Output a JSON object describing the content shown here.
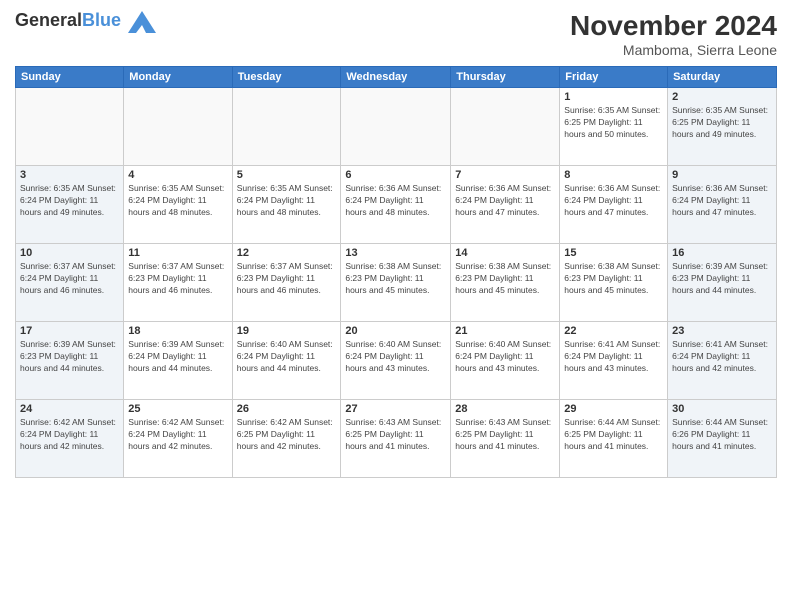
{
  "header": {
    "logo": {
      "general": "General",
      "blue": "Blue"
    },
    "title": "November 2024",
    "location": "Mamboma, Sierra Leone"
  },
  "weekdays": [
    "Sunday",
    "Monday",
    "Tuesday",
    "Wednesday",
    "Thursday",
    "Friday",
    "Saturday"
  ],
  "weeks": [
    [
      {
        "day": "",
        "info": ""
      },
      {
        "day": "",
        "info": ""
      },
      {
        "day": "",
        "info": ""
      },
      {
        "day": "",
        "info": ""
      },
      {
        "day": "",
        "info": ""
      },
      {
        "day": "1",
        "info": "Sunrise: 6:35 AM\nSunset: 6:25 PM\nDaylight: 11 hours and 50 minutes."
      },
      {
        "day": "2",
        "info": "Sunrise: 6:35 AM\nSunset: 6:25 PM\nDaylight: 11 hours and 49 minutes."
      }
    ],
    [
      {
        "day": "3",
        "info": "Sunrise: 6:35 AM\nSunset: 6:24 PM\nDaylight: 11 hours and 49 minutes."
      },
      {
        "day": "4",
        "info": "Sunrise: 6:35 AM\nSunset: 6:24 PM\nDaylight: 11 hours and 48 minutes."
      },
      {
        "day": "5",
        "info": "Sunrise: 6:35 AM\nSunset: 6:24 PM\nDaylight: 11 hours and 48 minutes."
      },
      {
        "day": "6",
        "info": "Sunrise: 6:36 AM\nSunset: 6:24 PM\nDaylight: 11 hours and 48 minutes."
      },
      {
        "day": "7",
        "info": "Sunrise: 6:36 AM\nSunset: 6:24 PM\nDaylight: 11 hours and 47 minutes."
      },
      {
        "day": "8",
        "info": "Sunrise: 6:36 AM\nSunset: 6:24 PM\nDaylight: 11 hours and 47 minutes."
      },
      {
        "day": "9",
        "info": "Sunrise: 6:36 AM\nSunset: 6:24 PM\nDaylight: 11 hours and 47 minutes."
      }
    ],
    [
      {
        "day": "10",
        "info": "Sunrise: 6:37 AM\nSunset: 6:24 PM\nDaylight: 11 hours and 46 minutes."
      },
      {
        "day": "11",
        "info": "Sunrise: 6:37 AM\nSunset: 6:23 PM\nDaylight: 11 hours and 46 minutes."
      },
      {
        "day": "12",
        "info": "Sunrise: 6:37 AM\nSunset: 6:23 PM\nDaylight: 11 hours and 46 minutes."
      },
      {
        "day": "13",
        "info": "Sunrise: 6:38 AM\nSunset: 6:23 PM\nDaylight: 11 hours and 45 minutes."
      },
      {
        "day": "14",
        "info": "Sunrise: 6:38 AM\nSunset: 6:23 PM\nDaylight: 11 hours and 45 minutes."
      },
      {
        "day": "15",
        "info": "Sunrise: 6:38 AM\nSunset: 6:23 PM\nDaylight: 11 hours and 45 minutes."
      },
      {
        "day": "16",
        "info": "Sunrise: 6:39 AM\nSunset: 6:23 PM\nDaylight: 11 hours and 44 minutes."
      }
    ],
    [
      {
        "day": "17",
        "info": "Sunrise: 6:39 AM\nSunset: 6:23 PM\nDaylight: 11 hours and 44 minutes."
      },
      {
        "day": "18",
        "info": "Sunrise: 6:39 AM\nSunset: 6:24 PM\nDaylight: 11 hours and 44 minutes."
      },
      {
        "day": "19",
        "info": "Sunrise: 6:40 AM\nSunset: 6:24 PM\nDaylight: 11 hours and 44 minutes."
      },
      {
        "day": "20",
        "info": "Sunrise: 6:40 AM\nSunset: 6:24 PM\nDaylight: 11 hours and 43 minutes."
      },
      {
        "day": "21",
        "info": "Sunrise: 6:40 AM\nSunset: 6:24 PM\nDaylight: 11 hours and 43 minutes."
      },
      {
        "day": "22",
        "info": "Sunrise: 6:41 AM\nSunset: 6:24 PM\nDaylight: 11 hours and 43 minutes."
      },
      {
        "day": "23",
        "info": "Sunrise: 6:41 AM\nSunset: 6:24 PM\nDaylight: 11 hours and 42 minutes."
      }
    ],
    [
      {
        "day": "24",
        "info": "Sunrise: 6:42 AM\nSunset: 6:24 PM\nDaylight: 11 hours and 42 minutes."
      },
      {
        "day": "25",
        "info": "Sunrise: 6:42 AM\nSunset: 6:24 PM\nDaylight: 11 hours and 42 minutes."
      },
      {
        "day": "26",
        "info": "Sunrise: 6:42 AM\nSunset: 6:25 PM\nDaylight: 11 hours and 42 minutes."
      },
      {
        "day": "27",
        "info": "Sunrise: 6:43 AM\nSunset: 6:25 PM\nDaylight: 11 hours and 41 minutes."
      },
      {
        "day": "28",
        "info": "Sunrise: 6:43 AM\nSunset: 6:25 PM\nDaylight: 11 hours and 41 minutes."
      },
      {
        "day": "29",
        "info": "Sunrise: 6:44 AM\nSunset: 6:25 PM\nDaylight: 11 hours and 41 minutes."
      },
      {
        "day": "30",
        "info": "Sunrise: 6:44 AM\nSunset: 6:26 PM\nDaylight: 11 hours and 41 minutes."
      }
    ]
  ]
}
